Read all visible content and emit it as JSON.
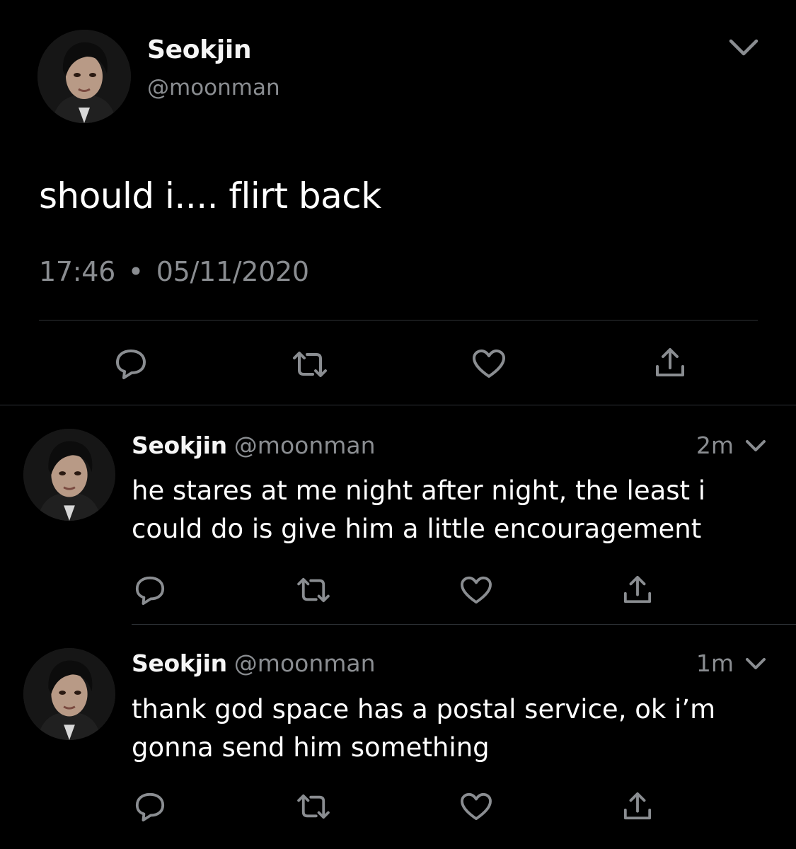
{
  "main_tweet": {
    "display_name": "Seokjin",
    "handle": "@moonman",
    "text": "should i.... flirt back",
    "time": "17:46",
    "separator": "•",
    "date": "05/11/2020"
  },
  "replies": [
    {
      "display_name": "Seokjin",
      "handle": "@moonman",
      "time": "2m",
      "text": "he stares at me night after night, the least i could do is give him a little encouragement"
    },
    {
      "display_name": "Seokjin",
      "handle": "@moonman",
      "time": "1m",
      "text": "thank god space has a postal service, ok i’m gonna send him something"
    }
  ],
  "icons": {
    "reply": "reply-icon",
    "retweet": "retweet-icon",
    "like": "like-icon",
    "share": "share-icon",
    "more": "chevron-down-icon"
  },
  "colors": {
    "background": "#000000",
    "text": "#ffffff",
    "secondary_text": "#8a8d91",
    "icon": "#8a8d91",
    "divider": "#2e3236"
  }
}
